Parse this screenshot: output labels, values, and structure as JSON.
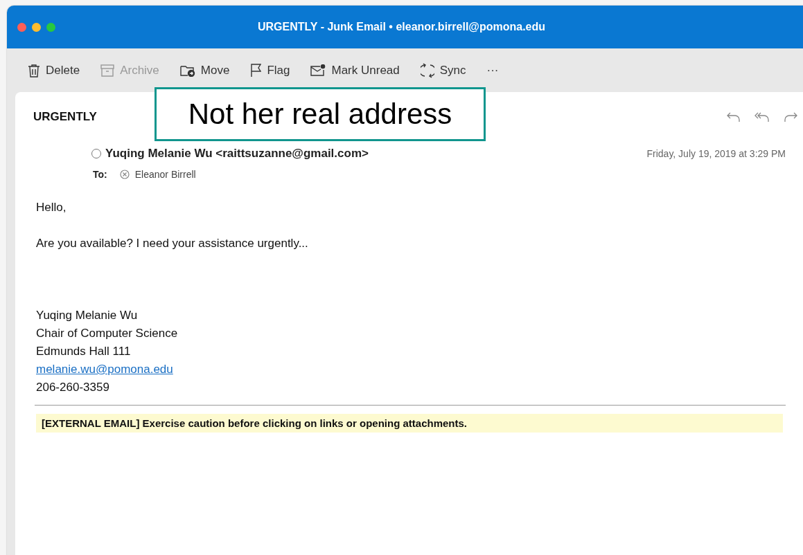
{
  "window": {
    "title": "URGENTLY - Junk Email • eleanor.birrell@pomona.edu"
  },
  "toolbar": [
    {
      "label": "Delete",
      "kind": "trash",
      "disabled": false
    },
    {
      "label": "Archive",
      "kind": "archive",
      "disabled": true
    },
    {
      "label": "Move",
      "kind": "move",
      "disabled": false
    },
    {
      "label": "Flag",
      "kind": "flag",
      "disabled": false
    },
    {
      "label": "Mark Unread",
      "kind": "unread",
      "disabled": false
    },
    {
      "label": "Sync",
      "kind": "sync",
      "disabled": false
    },
    {
      "label": "···",
      "kind": "more",
      "disabled": false
    }
  ],
  "message": {
    "subject": "URGENTLY",
    "from": "Yuqing Melanie Wu <raittsuzanne@gmail.com>",
    "to_label": "To:",
    "to": "Eleanor Birrell",
    "date": "Friday, July 19, 2019 at 3:29 PM",
    "body": [
      {
        "kind": "text",
        "text": "Hello,"
      },
      {
        "kind": "gap"
      },
      {
        "kind": "text",
        "text": "Are you available? I need your assistance urgently..."
      },
      {
        "kind": "gap"
      },
      {
        "kind": "gap"
      },
      {
        "kind": "gap"
      },
      {
        "kind": "text",
        "text": "Yuqing Melanie Wu"
      },
      {
        "kind": "text",
        "text": "Chair of Computer Science"
      },
      {
        "kind": "text",
        "text": "Edmunds Hall 111"
      },
      {
        "kind": "link",
        "text": "melanie.wu@pomona.edu"
      },
      {
        "kind": "text",
        "text": "206-260-3359"
      }
    ],
    "banner": "[EXTERNAL EMAIL] Exercise caution before clicking on links or opening attachments."
  },
  "annotation": {
    "text": "Not her real address"
  }
}
